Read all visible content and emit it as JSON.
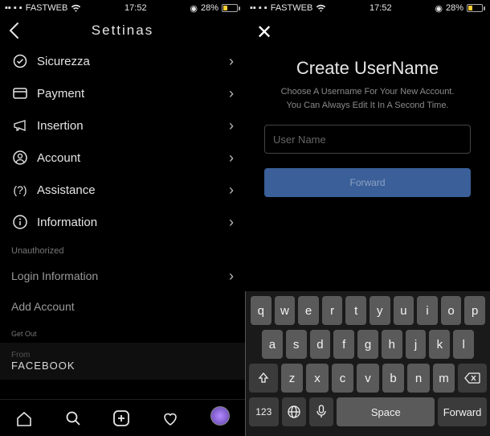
{
  "status": {
    "carrier": "FASTWEB",
    "time": "17:52",
    "battery_pct": "28%"
  },
  "left": {
    "header_title": "Settinas",
    "items": [
      {
        "icon": "shield-icon",
        "label": "Sicurezza"
      },
      {
        "icon": "card-icon",
        "label": "Payment"
      },
      {
        "icon": "megaphone-icon",
        "label": "Insertion"
      },
      {
        "icon": "person-icon",
        "label": "Account"
      },
      {
        "icon": "help-icon",
        "label": "Assistance"
      },
      {
        "icon": "info-icon",
        "label": "Information"
      }
    ],
    "section_unauth": "Unauthorized",
    "login_info": "Login Information",
    "add_account": "Add Account",
    "get_out": "Get Out",
    "from_label": "From",
    "from_value": "FACEBOOK"
  },
  "right": {
    "title": "Create UserName",
    "subtitle_line1": "Choose A Username For Your New Account.",
    "subtitle_line2": "You Can Always Edit It In A Second Time.",
    "placeholder": "User Name",
    "forward_btn": "Forward"
  },
  "keyboard": {
    "row1": [
      "q",
      "w",
      "e",
      "r",
      "t",
      "y",
      "u",
      "i",
      "o",
      "p"
    ],
    "row2": [
      "a",
      "s",
      "d",
      "f",
      "g",
      "h",
      "j",
      "k",
      "l"
    ],
    "row3_mid": [
      "z",
      "x",
      "c",
      "v",
      "b",
      "n",
      "m"
    ],
    "num_key": "123",
    "space": "Space",
    "forward": "Forward"
  }
}
